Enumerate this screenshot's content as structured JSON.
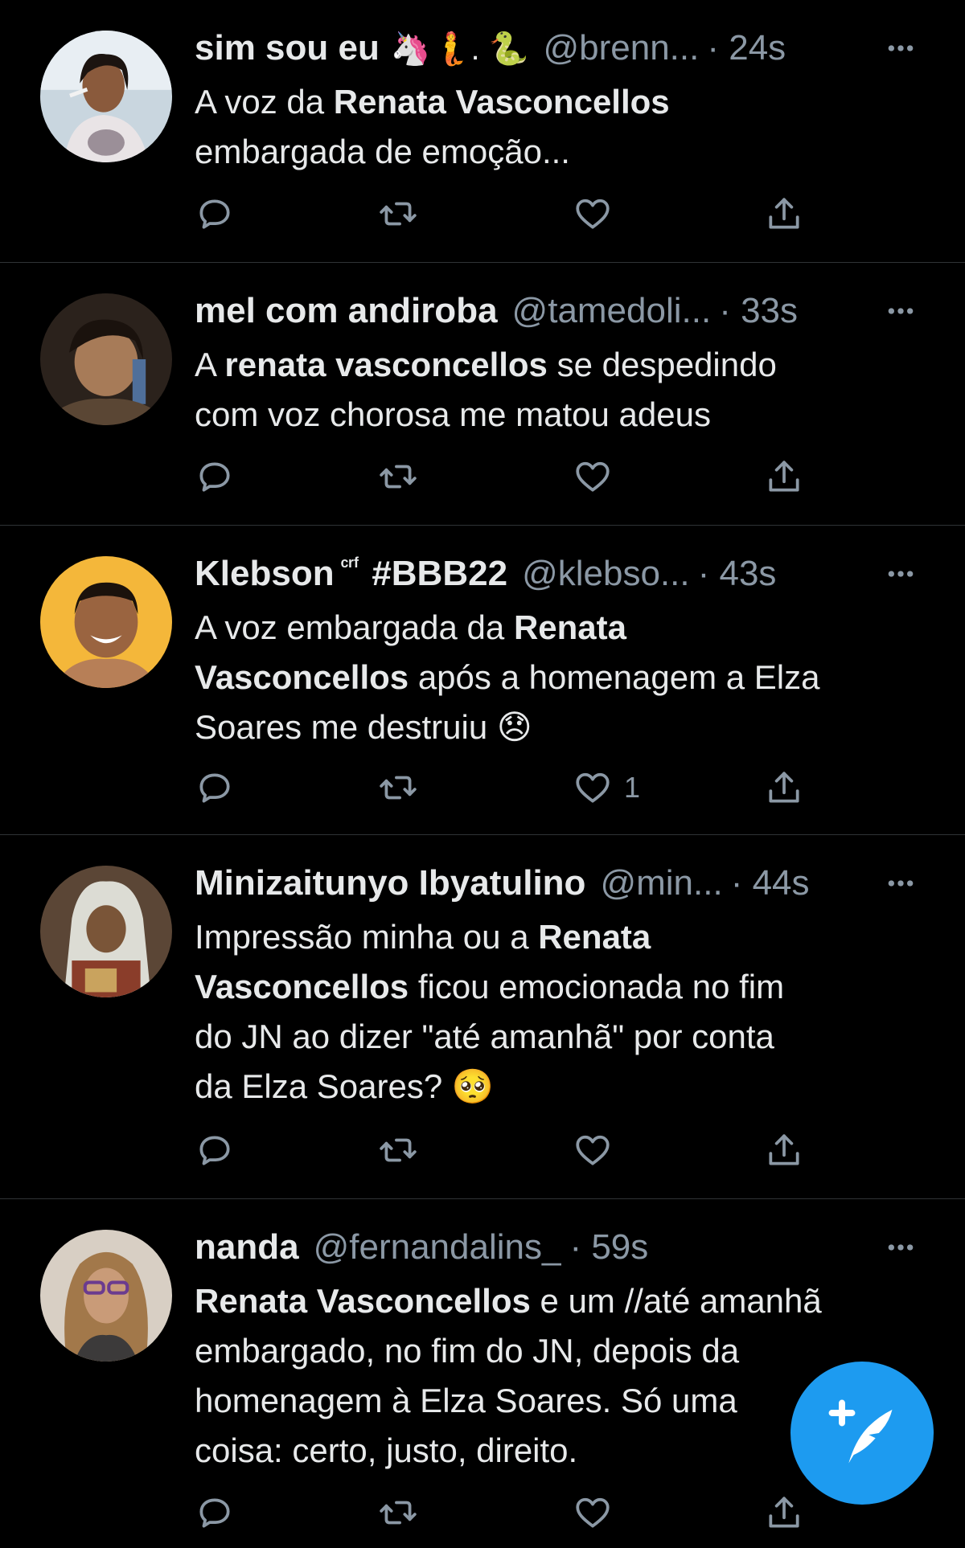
{
  "colors": {
    "background": "#000000",
    "text": "#e7e9ea",
    "muted": "#8b98a5",
    "divider": "#2f3336",
    "accent": "#1d9bf0"
  },
  "tweets": [
    {
      "name": "sim sou eu",
      "emoji": "🦄🧜. 🐍",
      "handle": "@brenn...",
      "time": "· 24s",
      "text_parts": [
        "A voz da ",
        "Renata Vasconcellos",
        "embargada de emoção..."
      ],
      "likes": ""
    },
    {
      "name": "mel com andiroba",
      "emoji": "",
      "handle": "@tamedoli...",
      "time": "· 33s",
      "text_parts": [
        "A ",
        "renata vasconcellos",
        " se despedindo",
        "com voz chorosa me matou adeus"
      ],
      "likes": ""
    },
    {
      "name": "Klebson",
      "name_sup": "ᶜʳᶠ",
      "name_tag": "#BBB22",
      "emoji": "",
      "handle": "@klebso...",
      "time": "· 43s",
      "text_parts": [
        "A voz embargada da ",
        "Renata",
        "Vasconcellos",
        " após a homenagem a Elza",
        "Soares me destruiu 😞"
      ],
      "likes": "1"
    },
    {
      "name": "Minizaitunyo Ibyatulino",
      "emoji": "",
      "handle": "@min...",
      "time": "· 44s",
      "text_parts": [
        "Impressão minha ou a ",
        "Renata",
        "Vasconcellos",
        " ficou emocionada no fim",
        "do JN ao dizer \"até amanhã\" por conta",
        "da Elza Soares? 🥺"
      ],
      "likes": ""
    },
    {
      "name": "nanda",
      "emoji": "",
      "handle": "@fernandalins_",
      "time": "· 59s",
      "text_parts": [
        "Renata Vasconcellos",
        " e um //até amanhã",
        "embargado, no fim do JN, depois da",
        "homenagem à Elza Soares. Só uma",
        "coisa: certo, justo, direito."
      ],
      "likes": ""
    }
  ],
  "icons": {
    "reply": "reply-icon",
    "retweet": "retweet-icon",
    "like": "heart-icon",
    "share": "share-icon",
    "more": "more-icon",
    "compose": "compose-tweet-icon"
  }
}
